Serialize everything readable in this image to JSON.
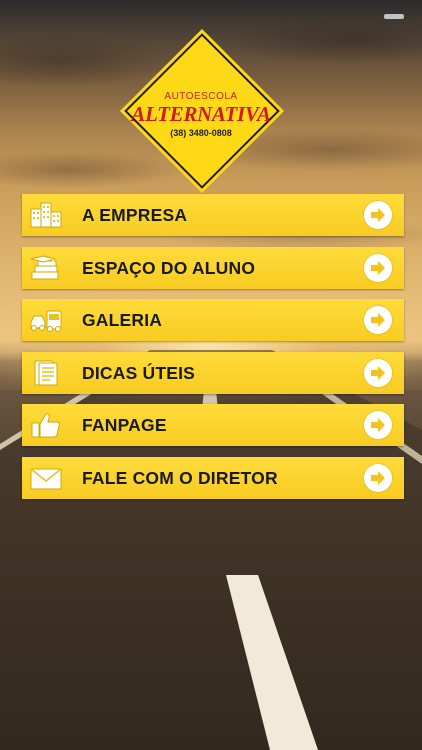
{
  "logo": {
    "top_text": "AUTOESCOLA",
    "brand": "ALTERNATIVA",
    "phone": "(38) 3480-0808"
  },
  "menu": [
    {
      "label": "A EMPRESA",
      "icon": "building-icon"
    },
    {
      "label": "ESPAÇO DO ALUNO",
      "icon": "books-icon"
    },
    {
      "label": "GALERIA",
      "icon": "vehicles-icon"
    },
    {
      "label": "DICAS ÚTEIS",
      "icon": "document-icon"
    },
    {
      "label": "FANPAGE",
      "icon": "thumbs-up-icon"
    },
    {
      "label": "FALE COM O DIRETOR",
      "icon": "envelope-icon"
    }
  ],
  "colors": {
    "button": "#f8cc22",
    "logo_yellow": "#ffd915",
    "logo_red": "#d1181b",
    "arrow": "#f5c21b"
  }
}
